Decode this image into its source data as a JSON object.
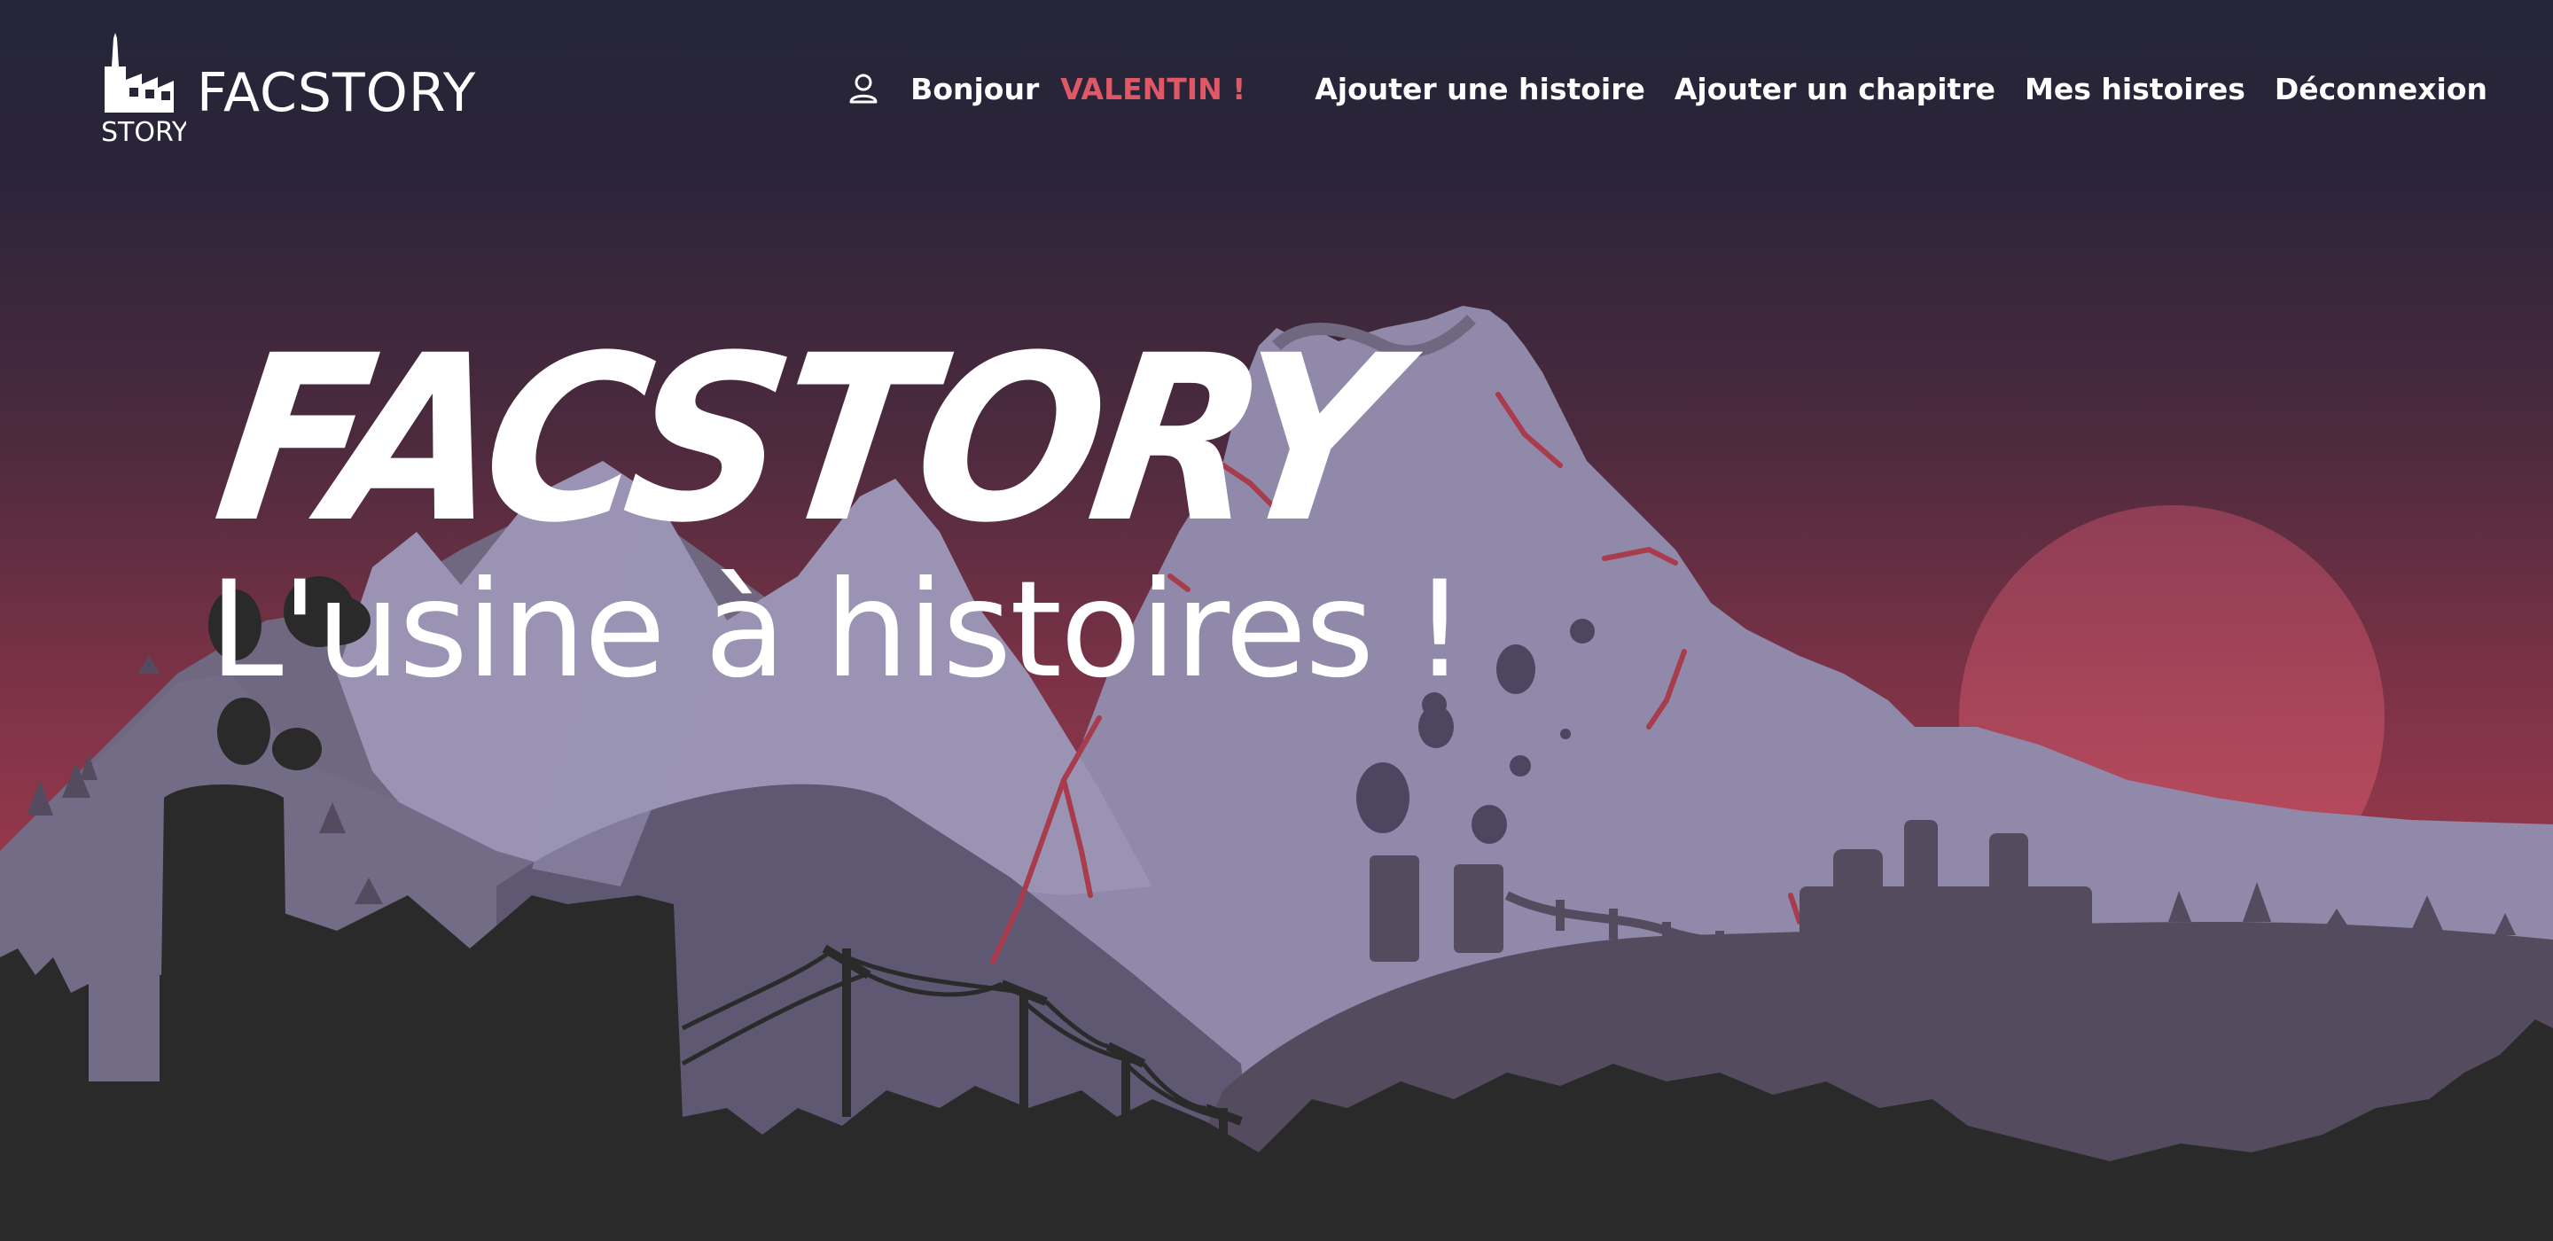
{
  "brand": {
    "logo_text": "STORY",
    "name": "FACSTORY"
  },
  "nav": {
    "user_icon": "user-icon",
    "greeting": "Bonjour",
    "username": "VALENTIN !",
    "links": [
      {
        "label": "Ajouter une histoire"
      },
      {
        "label": "Ajouter un chapitre"
      },
      {
        "label": "Mes histoires"
      },
      {
        "label": "Déconnexion"
      }
    ]
  },
  "hero": {
    "title": "FACSTORY",
    "subtitle": "L'usine à histoires !"
  },
  "colors": {
    "sky_top": "#262638",
    "sky_bottom": "#a03a4e",
    "sun": "#c24a5c",
    "mountain": "#9089aa",
    "accent": "#e05866",
    "foreground": "#2a2a2a"
  }
}
